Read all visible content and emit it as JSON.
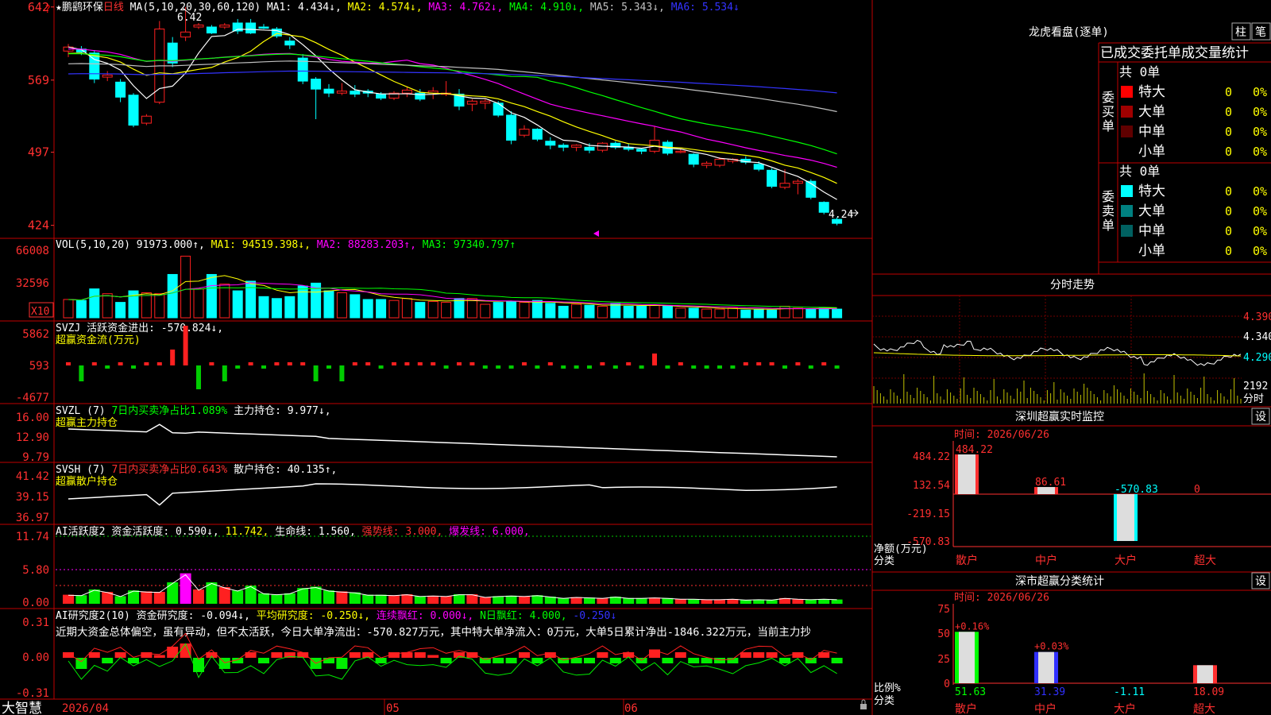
{
  "header": {
    "stock_name": "★鹏鹞环保",
    "period": "日线",
    "ma_label": "MA(5,10,20,30,60,120)",
    "ma_items": [
      {
        "label": "MA1:",
        "value": "4.434↓,",
        "color": "#ffffff"
      },
      {
        "label": "MA2:",
        "value": "4.574↓,",
        "color": "#ffff00"
      },
      {
        "label": "MA3:",
        "value": "4.762↓,",
        "color": "#ff00ff"
      },
      {
        "label": "MA4:",
        "value": "4.910↓,",
        "color": "#00ff00"
      },
      {
        "label": "MA5:",
        "value": "5.343↓,",
        "color": "#c0c0c0"
      },
      {
        "label": "MA6:",
        "value": "5.534↓",
        "color": "#3333ff"
      }
    ],
    "high_label": "6.42",
    "low_label": "4.24",
    "question_mark": "?"
  },
  "colors": {
    "up": "#ff2020",
    "down": "#00ffff",
    "frame": "#c00000",
    "axis_text": "#ff3030"
  },
  "price_axis": [
    "642",
    "569",
    "497",
    "424"
  ],
  "volume": {
    "title": "VOL(5,10,20)",
    "value": "91973.000↑,",
    "ma1": "MA1: 94519.398↓,",
    "ma2": "MA2: 88283.203↑,",
    "ma3": "MA3: 97340.797↑",
    "axis": [
      "66008",
      "32596"
    ],
    "unit": "X10"
  },
  "svzj": {
    "title": "SVZJ",
    "text": "活跃资金进出: -570.824↓,",
    "subtitle": "超赢资金流(万元)",
    "axis": [
      "5862",
      "593",
      "-4677"
    ]
  },
  "svzl": {
    "title": "SVZL (7)",
    "text1": "7日内买卖净占比1.089%",
    "text2": "主力持仓: 9.977↓,",
    "subtitle": "超赢主力持仓",
    "axis": [
      "16.00",
      "12.90",
      "9.79"
    ]
  },
  "svsh": {
    "title": "SVSH (7)",
    "text1": "7日内买卖净占比0.643%",
    "text2": "散户持仓: 40.135↑,",
    "subtitle": "超赢散户持仓",
    "axis": [
      "41.42",
      "39.15",
      "36.97"
    ]
  },
  "ai_active": {
    "title": "AI活跃度2",
    "text1": "资金活跃度: 0.590↓,",
    "text2": "11.742,",
    "text3": "生命线: 1.560,",
    "text4": "强势线: 3.000,",
    "text5": "爆发线: 6.000,",
    "axis": [
      "11.74",
      "5.80",
      "0.00"
    ]
  },
  "ai_research": {
    "title": "AI研究度2(10)",
    "text1": "资金研究度: -0.094↓,",
    "text2": "平均研究度: -0.250↓,",
    "text3": "连续飘红: 0.000↓,",
    "text4": "N日飘红: 4.000,",
    "text5": "-0.250↓",
    "comment": "近期大资金总体偏空，虽有异动，但不太活跃，今日大单净流出：-570.827万元，其中特大单净流入：0万元，大单5日累计净出-1846.322万元，当前主力抄",
    "axis": [
      "0.31",
      "0.00",
      "-0.31"
    ]
  },
  "date_axis": [
    "2026/04",
    "05",
    "06"
  ],
  "bottom_label": "大智慧",
  "right_panel": {
    "title": "龙虎看盘(逐单)",
    "tab1": "柱",
    "tab2": "笔",
    "order_header": "已成交委托单成交量统计",
    "buy_label": "委买单",
    "sell_label": "委卖单",
    "buy_total": "共 0单",
    "sell_total": "共 0单",
    "buy_rows": [
      {
        "name": "特大",
        "count": "0",
        "pct": "0%",
        "color": "#ff0000"
      },
      {
        "name": "大单",
        "count": "0",
        "pct": "0%",
        "color": "#a00000"
      },
      {
        "name": "中单",
        "count": "0",
        "pct": "0%",
        "color": "#600000"
      },
      {
        "name": "小单",
        "count": "0",
        "pct": "0%",
        "color": ""
      }
    ],
    "sell_rows": [
      {
        "name": "特大",
        "count": "0",
        "pct": "0%",
        "color": "#00ffff"
      },
      {
        "name": "大单",
        "count": "0",
        "pct": "0%",
        "color": "#008080"
      },
      {
        "name": "中单",
        "count": "0",
        "pct": "0%",
        "color": "#006060"
      },
      {
        "name": "小单",
        "count": "0",
        "pct": "0%",
        "color": ""
      }
    ],
    "intraday_title": "分时走势",
    "intraday_axis": [
      "4.390",
      "4.340",
      "4.290",
      "2192",
      "分时"
    ],
    "monitor_title": "深圳超赢实时监控",
    "monitor_setting": "设",
    "monitor_time": "时间: 2026/06/26",
    "monitor_axis": [
      "484.22",
      "132.54",
      "-219.15",
      "-570.83"
    ],
    "monitor_unit": "净额(万元)",
    "monitor_unit2": "分类",
    "monitor_bars": [
      {
        "cat": "散户",
        "value": 484.22,
        "label": "484.22"
      },
      {
        "cat": "中户",
        "value": 86.61,
        "label": "86.61"
      },
      {
        "cat": "大户",
        "value": -570.83,
        "label": "-570.83"
      },
      {
        "cat": "超大",
        "value": 0,
        "label": "0"
      }
    ],
    "stats_title": "深市超赢分类统计",
    "stats_setting": "设",
    "stats_time": "时间: 2026/06/26",
    "stats_axis": [
      "75",
      "50",
      "25",
      "0"
    ],
    "stats_unit": "比例%",
    "stats_unit2": "分类",
    "stats_bars": [
      {
        "cat": "散户",
        "value": 51.63,
        "top": "+0.16%",
        "label": "51.63"
      },
      {
        "cat": "中户",
        "value": 31.39,
        "top": "+0.03%",
        "label": "31.39"
      },
      {
        "cat": "大户",
        "value": -1.11,
        "top": "",
        "label": "-1.11"
      },
      {
        "cat": "超大",
        "value": 18.09,
        "top": "",
        "label": "18.09"
      }
    ]
  },
  "chart_data": {
    "type": "candlestick",
    "ylim": [
      4.15,
      6.45
    ],
    "candles": [
      [
        5.98,
        6.05,
        5.92,
        6.02
      ],
      [
        6.0,
        6.03,
        5.94,
        5.97
      ],
      [
        5.96,
        5.99,
        5.66,
        5.7
      ],
      [
        5.72,
        5.78,
        5.68,
        5.74
      ],
      [
        5.67,
        5.7,
        5.47,
        5.52
      ],
      [
        5.54,
        5.56,
        5.22,
        5.24
      ],
      [
        5.26,
        5.35,
        5.24,
        5.33
      ],
      [
        5.47,
        6.28,
        5.45,
        6.2
      ],
      [
        6.06,
        6.12,
        5.82,
        5.86
      ],
      [
        6.12,
        6.42,
        6.08,
        6.17
      ],
      [
        6.22,
        6.26,
        6.2,
        6.24
      ],
      [
        6.22,
        6.24,
        6.15,
        6.16
      ],
      [
        6.22,
        6.26,
        6.2,
        6.24
      ],
      [
        6.26,
        6.3,
        6.15,
        6.18
      ],
      [
        6.26,
        6.3,
        6.15,
        6.16
      ],
      [
        6.22,
        6.25,
        6.2,
        6.21
      ],
      [
        6.2,
        6.22,
        6.11,
        6.13
      ],
      [
        6.08,
        6.12,
        6.0,
        6.04
      ],
      [
        5.91,
        5.95,
        5.65,
        5.68
      ],
      [
        5.7,
        5.72,
        5.3,
        5.6
      ],
      [
        5.6,
        5.65,
        5.52,
        5.56
      ],
      [
        5.56,
        5.66,
        5.54,
        5.58
      ],
      [
        5.58,
        5.64,
        5.52,
        5.55
      ],
      [
        5.58,
        5.6,
        5.52,
        5.56
      ],
      [
        5.55,
        5.57,
        5.49,
        5.51
      ],
      [
        5.51,
        5.58,
        5.49,
        5.56
      ],
      [
        5.56,
        5.62,
        5.52,
        5.59
      ],
      [
        5.56,
        5.6,
        5.48,
        5.5
      ],
      [
        5.56,
        5.62,
        5.5,
        5.58
      ],
      [
        5.55,
        5.68,
        5.53,
        5.56
      ],
      [
        5.55,
        5.6,
        5.39,
        5.43
      ],
      [
        5.45,
        5.5,
        5.38,
        5.48
      ],
      [
        5.46,
        5.5,
        5.4,
        5.48
      ],
      [
        5.46,
        5.48,
        5.32,
        5.34
      ],
      [
        5.34,
        5.38,
        5.05,
        5.09
      ],
      [
        5.14,
        5.24,
        5.12,
        5.2
      ],
      [
        5.2,
        5.21,
        5.08,
        5.1
      ],
      [
        5.08,
        5.12,
        5.0,
        5.04
      ],
      [
        5.04,
        5.06,
        4.98,
        5.02
      ],
      [
        5.02,
        5.05,
        4.98,
        5.04
      ],
      [
        5.02,
        5.06,
        4.96,
        4.99
      ],
      [
        4.99,
        5.07,
        4.97,
        5.06
      ],
      [
        5.06,
        5.08,
        5.0,
        5.02
      ],
      [
        5.02,
        5.06,
        4.98,
        5.0
      ],
      [
        5.0,
        5.01,
        4.95,
        4.98
      ],
      [
        4.98,
        5.23,
        4.96,
        5.09
      ],
      [
        5.07,
        5.09,
        4.94,
        4.96
      ],
      [
        4.98,
        5.0,
        4.96,
        4.98
      ],
      [
        4.95,
        4.96,
        4.82,
        4.85
      ],
      [
        4.84,
        4.88,
        4.81,
        4.86
      ],
      [
        4.84,
        4.92,
        4.82,
        4.9
      ],
      [
        4.88,
        4.91,
        4.86,
        4.9
      ],
      [
        4.9,
        4.93,
        4.85,
        4.87
      ],
      [
        4.85,
        4.88,
        4.78,
        4.8
      ],
      [
        4.79,
        4.81,
        4.61,
        4.63
      ],
      [
        4.62,
        4.8,
        4.6,
        4.66
      ],
      [
        4.66,
        4.7,
        4.55,
        4.68
      ],
      [
        4.68,
        4.7,
        4.5,
        4.52
      ],
      [
        4.47,
        4.48,
        4.35,
        4.37
      ],
      [
        4.3,
        4.32,
        4.24,
        4.26
      ]
    ],
    "volume": [
      19,
      18,
      30,
      25,
      16,
      28,
      26,
      25,
      45,
      64,
      30,
      45,
      35,
      28,
      38,
      22,
      20,
      22,
      33,
      36,
      28,
      26,
      24,
      19,
      19,
      18,
      20,
      16,
      17,
      16,
      20,
      20,
      14,
      16,
      17,
      16,
      18,
      15,
      12,
      14,
      13,
      12,
      15,
      12,
      12,
      13,
      12,
      10,
      10,
      9,
      9,
      10,
      8,
      9,
      8,
      12,
      10,
      9,
      10,
      9
    ],
    "flow": [
      1,
      -2,
      1,
      -1,
      1,
      -1,
      1,
      0.5,
      2,
      5,
      -3,
      1,
      -2,
      -1,
      1,
      -1,
      1,
      1,
      1,
      -2,
      -1,
      -2,
      1,
      1,
      -1,
      1,
      1,
      1,
      0.5,
      -1,
      1,
      1,
      -1,
      -1,
      -1,
      1,
      -1,
      1,
      -1,
      -1,
      -1,
      1,
      -1,
      1,
      -1,
      1.5,
      -1,
      1,
      -1,
      -1,
      -1,
      -1,
      1,
      1,
      1,
      -1,
      1,
      -1,
      1,
      -1
    ]
  }
}
